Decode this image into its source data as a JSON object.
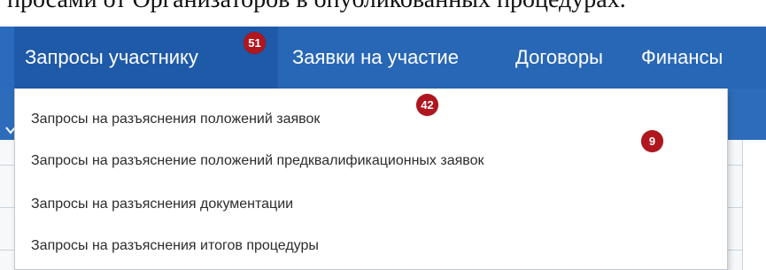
{
  "page": {
    "top_text": "просами от Организаторов в опубликованных процедурах."
  },
  "nav": {
    "items": [
      {
        "label": "Запросы участнику",
        "active": true
      },
      {
        "label": "Заявки на участие",
        "active": false
      },
      {
        "label": "Договоры",
        "active": false
      },
      {
        "label": "Финансы",
        "active": false
      }
    ],
    "badge_count": "51"
  },
  "dropdown": {
    "items": [
      {
        "label": "Запросы на разъяснения положений заявок",
        "badge": "42"
      },
      {
        "label": "Запросы на разъяснение положений предквалификационных заявок",
        "badge": "9"
      },
      {
        "label": "Запросы на разъяснения документации",
        "badge": ""
      },
      {
        "label": "Запросы на разъяснения итогов процедуры",
        "badge": ""
      }
    ]
  },
  "colors": {
    "nav_background": "#2867b6",
    "nav_active_background": "#1f5aa8",
    "badge": "#b0161d",
    "dropdown_background": "#ffffff",
    "dropdown_text": "#2c2c2c"
  },
  "icons": {
    "subbar_chevron": "chevron-down-icon"
  }
}
